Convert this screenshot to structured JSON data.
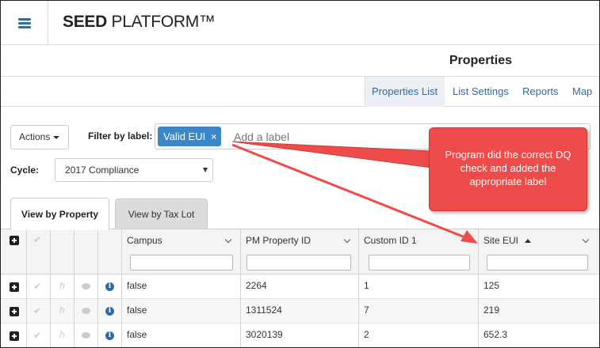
{
  "app": {
    "brand_bold": "SEED",
    "brand_rest": " PLATFORM™"
  },
  "page": {
    "title": "Properties"
  },
  "subnav": {
    "tabs": [
      {
        "label": "Properties List",
        "active": true
      },
      {
        "label": "List Settings",
        "active": false
      },
      {
        "label": "Reports",
        "active": false
      },
      {
        "label": "Map",
        "active": false
      }
    ]
  },
  "controls": {
    "actions_label": "Actions",
    "filter_label": "Filter by label:",
    "applied_label": "Valid EUI",
    "remove_symbol": "×",
    "add_label_placeholder": "Add a label",
    "cycle_label": "Cycle:",
    "cycle_value": "2017 Compliance"
  },
  "view_tabs": {
    "property": "View by Property",
    "taxlot": "View by Tax Lot"
  },
  "grid": {
    "columns": [
      "Campus",
      "PM Property ID",
      "Custom ID 1",
      "Site EUI"
    ],
    "rows": [
      {
        "campus": "false",
        "pm_property_id": "2264",
        "custom_id_1": "1",
        "site_eui": "125"
      },
      {
        "campus": "false",
        "pm_property_id": "1311524",
        "custom_id_1": "7",
        "site_eui": "219"
      },
      {
        "campus": "false",
        "pm_property_id": "3020139",
        "custom_id_1": "2",
        "site_eui": "652.3"
      }
    ]
  },
  "annotation": {
    "text": "Program did the correct DQ check and added the appropriate label",
    "color": "#ee4b4b"
  },
  "colors": {
    "accent": "#2b6cb0",
    "tag": "#3a87c9"
  }
}
